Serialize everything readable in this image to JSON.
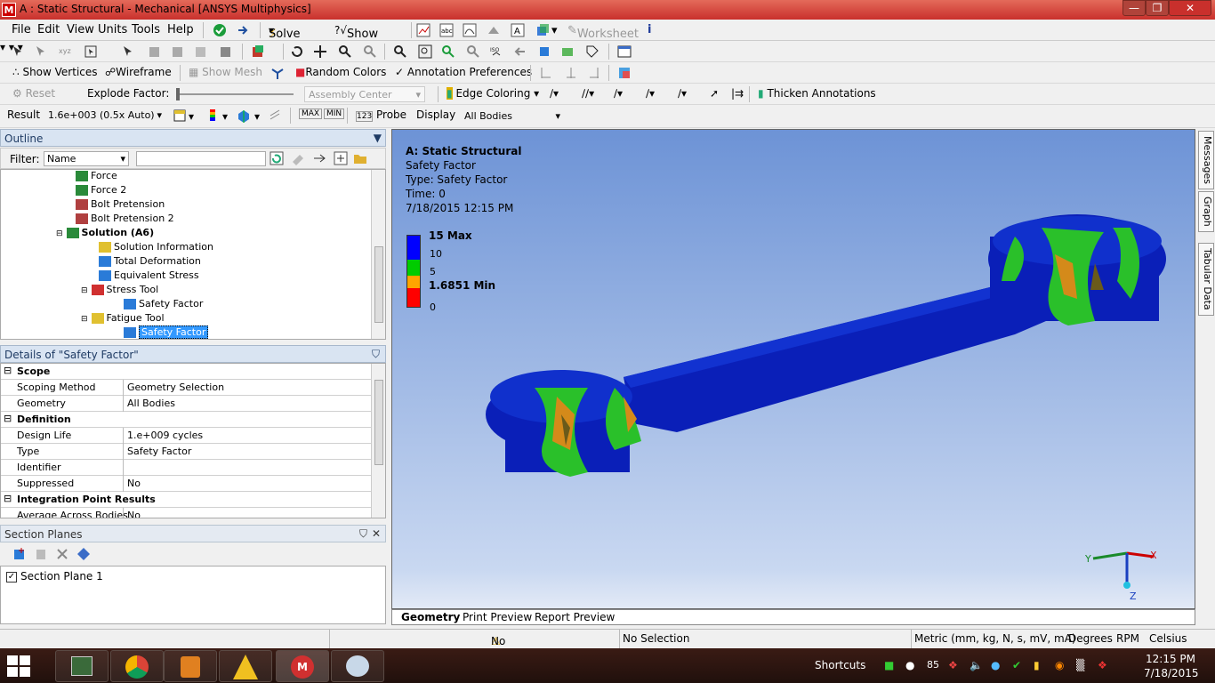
{
  "window": {
    "title": "A : Static Structural - Mechanical [ANSYS Multiphysics]",
    "icon": "M"
  },
  "menu": [
    "File",
    "Edit",
    "View",
    "Units",
    "Tools",
    "Help"
  ],
  "toolbar1": {
    "solve": "Solve",
    "show_errors": "Show Errors",
    "worksheet": "Worksheet"
  },
  "toolbar2": {
    "show_vertices": "Show Vertices",
    "wireframe": "Wireframe",
    "show_mesh": "Show Mesh",
    "random_colors": "Random Colors",
    "annotation_prefs": "Annotation Preferences"
  },
  "toolbar3": {
    "reset": "Reset",
    "explode_factor": "Explode Factor:",
    "assembly_center": "Assembly Center",
    "edge_coloring": "Edge Coloring",
    "thicken_annotations": "Thicken Annotations"
  },
  "toolbar4": {
    "result_label": "Result",
    "result_value": "1.6e+003 (0.5x Auto)",
    "probe": "Probe",
    "display_label": "Display",
    "display_value": "All Bodies"
  },
  "outline": {
    "title": "Outline",
    "filter_label": "Filter:",
    "filter_value": "Name",
    "items": [
      {
        "label": "Force",
        "bold": false
      },
      {
        "label": "Force 2",
        "bold": false
      },
      {
        "label": "Bolt Pretension",
        "bold": false
      },
      {
        "label": "Bolt Pretension 2",
        "bold": false
      },
      {
        "label": "Solution (A6)",
        "bold": true
      },
      {
        "label": "Solution Information",
        "bold": false
      },
      {
        "label": "Total Deformation",
        "bold": false
      },
      {
        "label": "Equivalent Stress",
        "bold": false
      },
      {
        "label": "Stress Tool",
        "bold": false
      },
      {
        "label": "Safety Factor",
        "bold": false
      },
      {
        "label": "Fatigue Tool",
        "bold": false
      },
      {
        "label": "Safety Factor",
        "bold": false
      }
    ]
  },
  "details": {
    "title": "Details of \"Safety Factor\"",
    "rows": [
      {
        "k": "Scope",
        "v": "",
        "group": true
      },
      {
        "k": "Scoping Method",
        "v": "Geometry Selection",
        "group": false
      },
      {
        "k": "Geometry",
        "v": "All Bodies",
        "group": false
      },
      {
        "k": "Definition",
        "v": "",
        "group": true
      },
      {
        "k": "Design Life",
        "v": "1.e+009 cycles",
        "group": false
      },
      {
        "k": "Type",
        "v": "Safety Factor",
        "group": false
      },
      {
        "k": "Identifier",
        "v": "",
        "group": false
      },
      {
        "k": "Suppressed",
        "v": "No",
        "group": false
      },
      {
        "k": "Integration Point Results",
        "v": "",
        "group": true
      },
      {
        "k": "Average Across Bodies",
        "v": "No",
        "group": false
      }
    ]
  },
  "section_planes": {
    "title": "Section Planes",
    "item": "Section Plane 1"
  },
  "graphics": {
    "info": {
      "title": "A: Static Structural",
      "line1": "Safety Factor",
      "line2": "Type: Safety Factor",
      "line3": "Time: 0",
      "line4": "7/18/2015 12:15 PM"
    },
    "legend": {
      "max": "15 Max",
      "l10": "10",
      "l5": "5",
      "min": "1.6851 Min",
      "l0": "0"
    },
    "legend_colors": [
      "#0000ff",
      "#00cc00",
      "#ffa500",
      "#ff0000"
    ],
    "axes": {
      "x": "X",
      "y": "Y",
      "z": "Z"
    }
  },
  "view_tabs": [
    "Geometry",
    "Print Preview",
    "Report Preview"
  ],
  "side_tabs": [
    "Messages",
    "Graph",
    "Tabular Data"
  ],
  "status": {
    "messages": "No Messages",
    "selection": "No Selection",
    "units": "Metric (mm, kg, N, s, mV, mA)",
    "degrees": "Degrees",
    "rpm": "RPM",
    "celsius": "Celsius"
  },
  "taskbar": {
    "shortcuts": "Shortcuts",
    "count": "85",
    "time": "12:15 PM",
    "date": "7/18/2015"
  }
}
